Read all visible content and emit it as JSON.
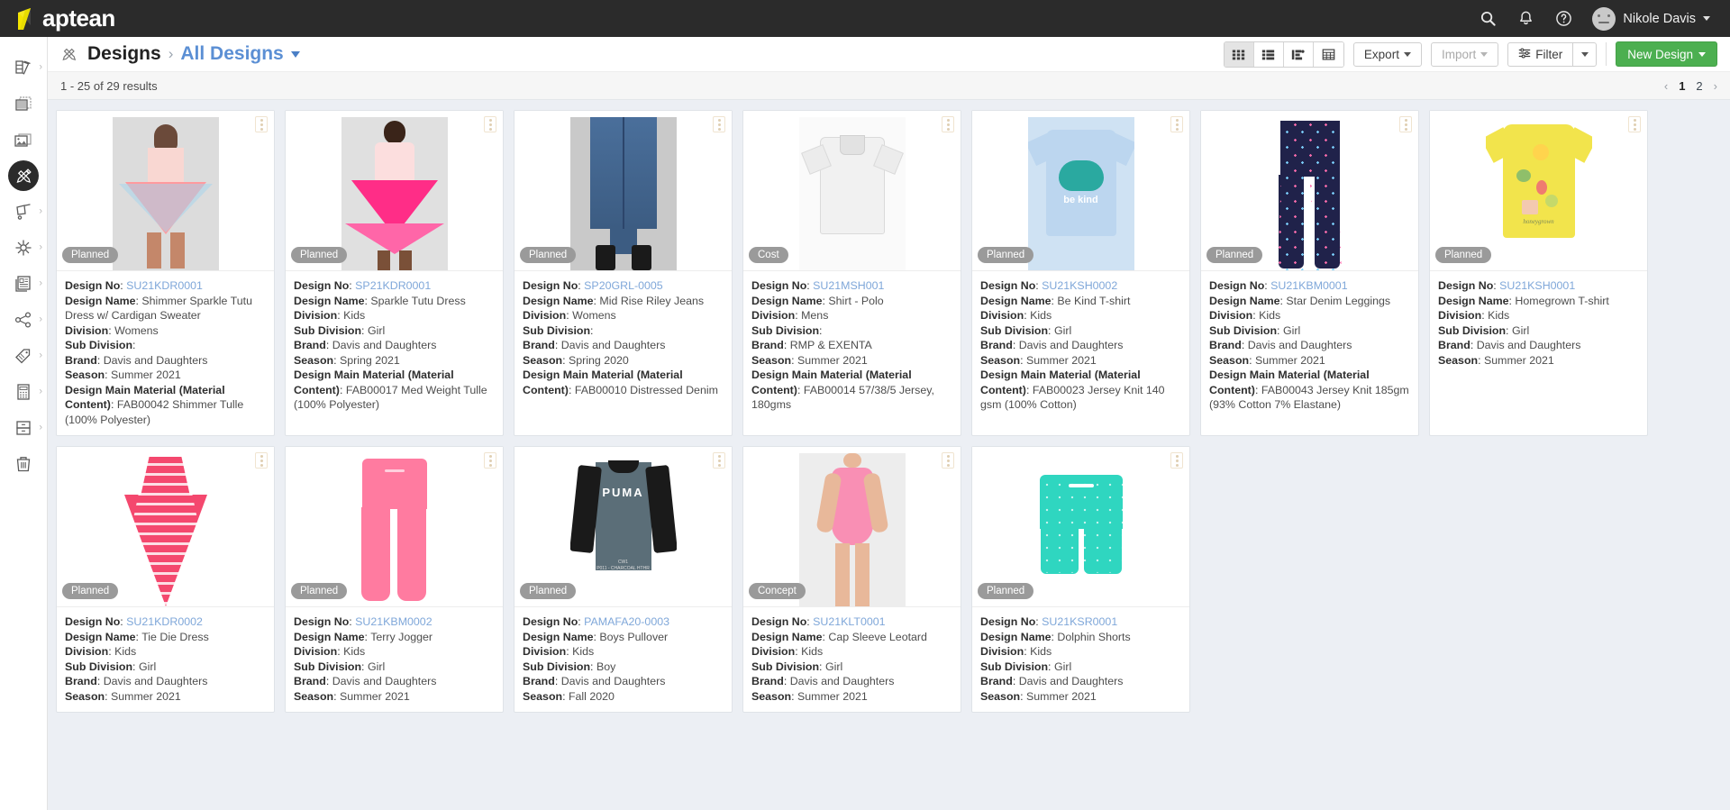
{
  "brand": {
    "name": "aptean"
  },
  "topbar": {
    "icons": [
      "search-icon",
      "bell-icon",
      "help-icon"
    ],
    "user": "Nikole Davis"
  },
  "sidebar": {
    "items": [
      {
        "name": "color-palette",
        "has_chevron": true,
        "active": false
      },
      {
        "name": "fabric-swatches",
        "has_chevron": false,
        "active": false
      },
      {
        "name": "images",
        "has_chevron": false,
        "active": false
      },
      {
        "name": "designs",
        "has_chevron": false,
        "active": true
      },
      {
        "name": "sourcing",
        "has_chevron": true,
        "active": false
      },
      {
        "name": "testing",
        "has_chevron": true,
        "active": false
      },
      {
        "name": "documents",
        "has_chevron": true,
        "active": false
      },
      {
        "name": "share",
        "has_chevron": true,
        "active": false
      },
      {
        "name": "labels",
        "has_chevron": true,
        "active": false
      },
      {
        "name": "costing",
        "has_chevron": true,
        "active": false
      },
      {
        "name": "archive",
        "has_chevron": true,
        "active": false
      },
      {
        "name": "trash",
        "has_chevron": false,
        "active": false
      }
    ]
  },
  "breadcrumb": {
    "icon": "design-tools-icon",
    "root": "Designs",
    "separator": "›",
    "current": "All Designs"
  },
  "toolbar": {
    "views": [
      {
        "name": "grid-view",
        "selected": true
      },
      {
        "name": "list-view",
        "selected": false
      },
      {
        "name": "board-view",
        "selected": false
      },
      {
        "name": "table-view",
        "selected": false
      }
    ],
    "export_label": "Export",
    "import_label": "Import",
    "filter_label": "Filter",
    "new_design_label": "New Design",
    "primary_color": "#4caf50"
  },
  "results": {
    "summary": "1 - 25 of 29 results",
    "prev": "‹",
    "next": "›",
    "pages": [
      "1",
      "2"
    ],
    "current_page": "1"
  },
  "labels": {
    "design_no": "Design No",
    "design_name": "Design Name",
    "division": "Division",
    "sub_division": "Sub Division",
    "brand": "Brand",
    "season": "Season",
    "material": "Design Main Material (Material Content)"
  },
  "cards": [
    {
      "design_no": "SU21KDR0001",
      "design_name": "Shimmer Sparkle Tutu Dress w/ Cardigan Sweater",
      "division": "Womens",
      "sub_division": "",
      "brand": "Davis and Daughters",
      "season": "Summer 2021",
      "material": "FAB00042 Shimmer Tulle (100% Polyester)",
      "status": "Planned",
      "image": "pink-tutu-dress"
    },
    {
      "design_no": "SP21KDR0001",
      "design_name": "Sparkle Tutu Dress",
      "division": "Kids",
      "sub_division": "Girl",
      "brand": "Davis and Daughters",
      "season": "Spring 2021",
      "material": "FAB00017 Med Weight Tulle (100% Polyester)",
      "status": "Planned",
      "image": "hot-pink-tutu"
    },
    {
      "design_no": "SP20GRL-0005",
      "design_name": "Mid Rise Riley Jeans",
      "division": "Womens",
      "sub_division": "",
      "brand": "Davis and Daughters",
      "season": "Spring 2020",
      "material": "FAB00010 Distressed Denim",
      "status": "Planned",
      "image": "denim-jeans"
    },
    {
      "design_no": "SU21MSH001",
      "design_name": "Shirt - Polo",
      "division": "Mens",
      "sub_division": "",
      "brand": "RMP & EXENTA",
      "season": "Summer 2021",
      "material": "FAB00014 57/38/5 Jersey, 180gms",
      "status": "Cost",
      "image": "white-polo"
    },
    {
      "design_no": "SU21KSH0002",
      "design_name": "Be Kind T-shirt",
      "division": "Kids",
      "sub_division": "Girl",
      "brand": "Davis and Daughters",
      "season": "Summer 2021",
      "material": "FAB00023 Jersey Knit 140 gsm (100% Cotton)",
      "status": "Planned",
      "image": "bekind-tee"
    },
    {
      "design_no": "SU21KBM0001",
      "design_name": "Star Denim Leggings",
      "division": "Kids",
      "sub_division": "Girl",
      "brand": "Davis and Daughters",
      "season": "Summer 2021",
      "material": "FAB00043 Jersey Knit 185gm (93% Cotton 7% Elastane)",
      "status": "Planned",
      "image": "star-leggings"
    },
    {
      "design_no": "SU21KSH0001",
      "design_name": "Homegrown T-shirt",
      "division": "Kids",
      "sub_division": "Girl",
      "brand": "Davis and Daughters",
      "season": "Summer 2021",
      "material": "",
      "status": "Planned",
      "image": "yellow-tee"
    },
    {
      "design_no": "SU21KDR0002",
      "design_name": "Tie Die Dress",
      "division": "Kids",
      "sub_division": "Girl",
      "brand": "Davis and Daughters",
      "season": "Summer 2021",
      "material": "",
      "status": "Planned",
      "image": "tie-dye-dress"
    },
    {
      "design_no": "SU21KBM0002",
      "design_name": "Terry Jogger",
      "division": "Kids",
      "sub_division": "Girl",
      "brand": "Davis and Daughters",
      "season": "Summer 2021",
      "material": "",
      "status": "Planned",
      "image": "pink-jogger"
    },
    {
      "design_no": "PAMAFA20-0003",
      "design_name": "Boys Pullover",
      "division": "Kids",
      "sub_division": "Boy",
      "brand": "Davis and Daughters",
      "season": "Fall 2020",
      "material": "",
      "status": "Planned",
      "image": "puma-pullover"
    },
    {
      "design_no": "SU21KLT0001",
      "design_name": "Cap Sleeve Leotard",
      "division": "Kids",
      "sub_division": "Girl",
      "brand": "Davis and Daughters",
      "season": "Summer 2021",
      "material": "",
      "status": "Concept",
      "image": "pink-leotard"
    },
    {
      "design_no": "SU21KSR0001",
      "design_name": "Dolphin Shorts",
      "division": "Kids",
      "sub_division": "Girl",
      "brand": "Davis and Daughters",
      "season": "Summer 2021",
      "material": "",
      "status": "Planned",
      "image": "teal-shorts"
    }
  ]
}
